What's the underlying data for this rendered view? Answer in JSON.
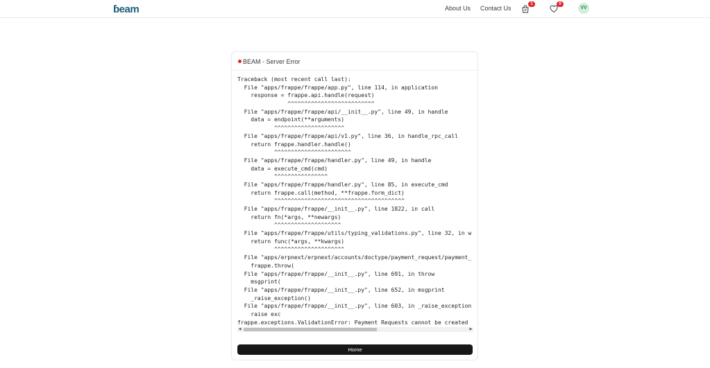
{
  "navbar": {
    "logo_text": "BEAM",
    "about_label": "About Us",
    "contact_label": "Contact Us",
    "cart_icon": "shopping-bag-icon",
    "cart_count": "1",
    "wishlist_icon": "heart-icon",
    "wishlist_count": "0",
    "avatar_initials": "VV"
  },
  "colors": {
    "accent": "#1a5f7a",
    "badge": "#e02424",
    "button": "#171717"
  },
  "card": {
    "title": "BEAM - Server Error",
    "traceback": [
      "Traceback (most recent call last):",
      "  File \"apps/frappe/frappe/app.py\", line 114, in application",
      "    response = frappe.api.handle(request)",
      "               ^^^^^^^^^^^^^^^^^^^^^^^^^^",
      "  File \"apps/frappe/frappe/api/__init__.py\", line 49, in handle",
      "    data = endpoint(**arguments)",
      "           ^^^^^^^^^^^^^^^^^^^^^",
      "  File \"apps/frappe/frappe/api/v1.py\", line 36, in handle_rpc_call",
      "    return frappe.handler.handle()",
      "           ^^^^^^^^^^^^^^^^^^^^^^^",
      "  File \"apps/frappe/frappe/handler.py\", line 49, in handle",
      "    data = execute_cmd(cmd)",
      "           ^^^^^^^^^^^^^^^^",
      "  File \"apps/frappe/frappe/handler.py\", line 85, in execute_cmd",
      "    return frappe.call(method, **frappe.form_dict)",
      "           ^^^^^^^^^^^^^^^^^^^^^^^^^^^^^^^^^^^^^^^",
      "  File \"apps/frappe/frappe/__init__.py\", line 1822, in call",
      "    return fn(*args, **newargs)",
      "           ^^^^^^^^^^^^^^^^^^^^",
      "  File \"apps/frappe/frappe/utils/typing_validations.py\", line 32, in w",
      "    return func(*args, **kwargs)",
      "           ^^^^^^^^^^^^^^^^^^^^^",
      "  File \"apps/erpnext/erpnext/accounts/doctype/payment_request/payment_",
      "    frappe.throw(",
      "  File \"apps/frappe/frappe/__init__.py\", line 691, in throw",
      "    msgprint(",
      "  File \"apps/frappe/frappe/__init__.py\", line 652, in msgprint",
      "    _raise_exception()",
      "  File \"apps/frappe/frappe/__init__.py\", line 603, in _raise_exception",
      "    raise exc",
      "frappe.exceptions.ValidationError: Payment Requests cannot be created"
    ],
    "home_label": "Home"
  }
}
